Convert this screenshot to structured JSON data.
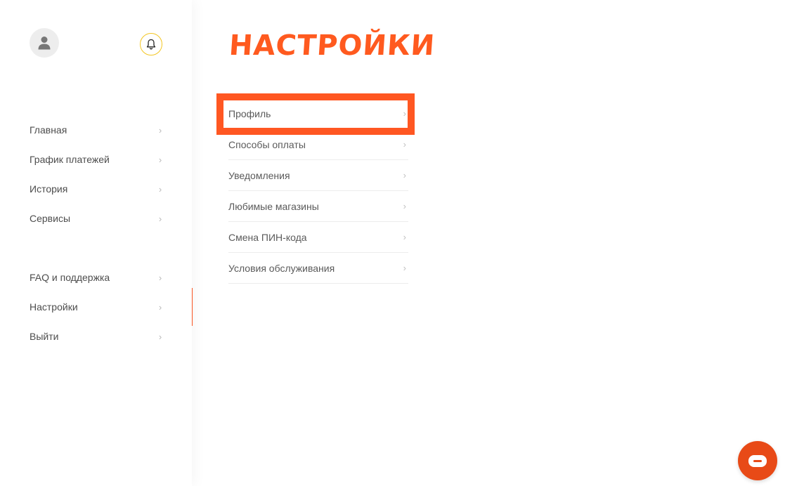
{
  "sidebar": {
    "avatar_icon": "user-icon",
    "bell_icon": "bell-icon",
    "primary_items": [
      {
        "label": "Главная"
      },
      {
        "label": "График платежей"
      },
      {
        "label": "История"
      },
      {
        "label": "Сервисы"
      }
    ],
    "secondary_items": [
      {
        "label": "FAQ и поддержка"
      },
      {
        "label": "Настройки",
        "selected": true
      },
      {
        "label": "Выйти"
      }
    ]
  },
  "main": {
    "title": "НАСТРОЙКИ",
    "menu": [
      {
        "label": "Профиль",
        "selected": true
      },
      {
        "label": "Способы оплаты"
      },
      {
        "label": "Уведомления"
      },
      {
        "label": "Любимые магазины"
      },
      {
        "label": "Смена ПИН-кода"
      },
      {
        "label": "Условия обслуживания"
      }
    ]
  },
  "chat": {
    "icon": "chat-bubble-icon"
  },
  "colors": {
    "accent": "#ff5a1f",
    "highlight": "#ff5722",
    "bell_ring": "#f3c623",
    "chat_button": "#e84a17"
  }
}
